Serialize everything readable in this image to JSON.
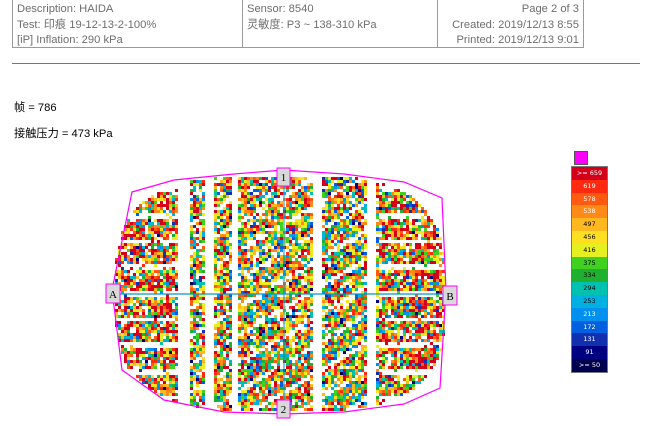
{
  "header": {
    "description": "Description: HAIDA",
    "test": "Test: 印痕 19-12-13-2-100%",
    "inflation": "[iP] Inflation: 290 kPa",
    "sensor": "Sensor: 8540",
    "sensitivity": "灵敏度: P3 ~ 138-310 kPa",
    "page": "Page 2 of 3",
    "created": "Created: 2019/12/13 8:55",
    "printed": "Printed: 2019/12/13 9:01"
  },
  "readout": {
    "frame": "帧  = 786",
    "contact_pressure": "接触压力  = 473 kPa"
  },
  "markers": {
    "top": "1",
    "bottom": "2",
    "left": "A",
    "right": "B"
  },
  "legend": {
    "items": [
      {
        "label": ">= 659",
        "color": "#d4001a",
        "text": "#ffffff"
      },
      {
        "label": "619",
        "color": "#ff2a10",
        "text": "#ffffff"
      },
      {
        "label": "578",
        "color": "#ff5a10",
        "text": "#ffffff"
      },
      {
        "label": "538",
        "color": "#ff8a18",
        "text": "#ffffff"
      },
      {
        "label": "497",
        "color": "#ffb820",
        "text": "#000000"
      },
      {
        "label": "456",
        "color": "#ffe020",
        "text": "#000000"
      },
      {
        "label": "416",
        "color": "#e6f020",
        "text": "#000000"
      },
      {
        "label": "375",
        "color": "#40d020",
        "text": "#000000"
      },
      {
        "label": "334",
        "color": "#20b030",
        "text": "#000000"
      },
      {
        "label": "294",
        "color": "#00c0b0",
        "text": "#000000"
      },
      {
        "label": "253",
        "color": "#00b0e0",
        "text": "#000000"
      },
      {
        "label": "213",
        "color": "#0090f0",
        "text": "#ffffff"
      },
      {
        "label": "172",
        "color": "#0060e0",
        "text": "#ffffff"
      },
      {
        "label": "131",
        "color": "#1030b0",
        "text": "#ffffff"
      },
      {
        "label": "91",
        "color": "#000080",
        "text": "#ffffff"
      },
      {
        "label": ">= 50",
        "color": "#000050",
        "text": "#ffffff"
      }
    ],
    "top_swatch_color": "#ff00ff"
  },
  "colors": {
    "outline": "#ff00ff",
    "axis": "#0099cc"
  }
}
